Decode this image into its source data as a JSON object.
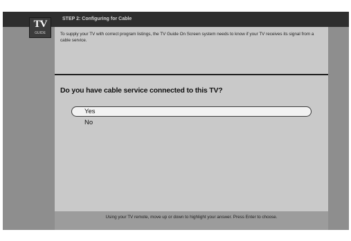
{
  "header": {
    "logo_main": "TV",
    "logo_sub": "GUIDE",
    "title": "STEP 2: Configuring for Cable"
  },
  "intro_text": "To supply your TV with correct program listings, the TV Guide On Screen system needs to know if your TV receives its signal from a cable service.",
  "question": "Do you have cable service connected to this TV?",
  "options": [
    {
      "label": "Yes",
      "selected": true
    },
    {
      "label": "No",
      "selected": false
    }
  ],
  "footer_text": "Using your TV remote, move up or down to highlight your answer. Press Enter to choose.",
  "colors": {
    "screen_background": "#8e8e8e",
    "panel_background": "#c9c9c9",
    "header_bar": "#2e2e2e",
    "selected_option": "#f2f2f2"
  }
}
